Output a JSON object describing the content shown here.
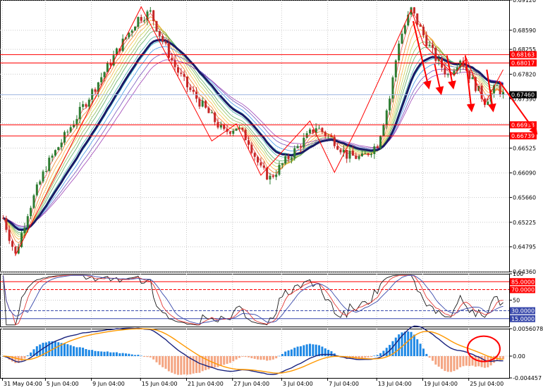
{
  "colors": {
    "background": "#ffffff",
    "grid": "#c8c8c8",
    "bull": "#2e7d32",
    "bear": "#c62828",
    "ma_slow": "#1a1a66",
    "red": "#ff0000",
    "rsi_main": "#1a1a1a",
    "rsi_alt1": "#e53935",
    "rsi_alt2": "#3949ab",
    "macd_pos": "#1e88e5",
    "macd_neg": "#f4a582",
    "macd_line": "#1a237e",
    "signal_line": "#ff9800",
    "current_tag": "#000000"
  },
  "icons": [
    "highlight-circle",
    "trend-arrow"
  ],
  "chart_data": [
    {
      "type": "candlestick",
      "ylim": [
        0.6436,
        0.6912
      ],
      "y_ticks": [
        "0.69120",
        "0.68590",
        "0.68255",
        "0.67820",
        "0.67390",
        "0.66955",
        "0.66525",
        "0.66090",
        "0.65660",
        "0.65225",
        "0.64795",
        "0.64360"
      ],
      "tick_values": [
        0.6912,
        0.6859,
        0.68255,
        0.6782,
        0.6739,
        0.66955,
        0.66525,
        0.6609,
        0.6566,
        0.65225,
        0.64795,
        0.6436
      ],
      "x_labels": [
        "31 May 04:00",
        "5 Jun 04:00",
        "9 Jun 04:00",
        "15 Jun 04:00",
        "21 Jun 04:00",
        "27 Jun 04:00",
        "3 Jul 04:00",
        "7 Jul 04:00",
        "13 Jul 04:00",
        "19 Jul 04:00",
        "25 Jul 04:00"
      ],
      "label_bar_index": [
        0,
        14,
        29,
        45,
        60,
        75,
        91,
        106,
        122,
        137,
        152
      ],
      "bar_count": 164,
      "grid": true,
      "horizontal_levels": [
        {
          "value": 0.68163,
          "label": "0.68163"
        },
        {
          "value": 0.68017,
          "label": "0.68017"
        },
        {
          "value": 0.66933,
          "label": "0.66933"
        },
        {
          "value": 0.66739,
          "label": "0.66739"
        }
      ],
      "current_price": {
        "value": 0.6746,
        "label": "0.67460"
      },
      "price_path": [
        [
          0,
          0.653
        ],
        [
          4,
          0.6465
        ],
        [
          8,
          0.654
        ],
        [
          14,
          0.662
        ],
        [
          22,
          0.669
        ],
        [
          30,
          0.676
        ],
        [
          38,
          0.683
        ],
        [
          44,
          0.688
        ],
        [
          48,
          0.689
        ],
        [
          52,
          0.684
        ],
        [
          56,
          0.6795
        ],
        [
          60,
          0.676
        ],
        [
          66,
          0.672
        ],
        [
          72,
          0.668
        ],
        [
          76,
          0.669
        ],
        [
          80,
          0.6665
        ],
        [
          84,
          0.6615
        ],
        [
          87,
          0.66
        ],
        [
          92,
          0.663
        ],
        [
          97,
          0.666
        ],
        [
          102,
          0.669
        ],
        [
          108,
          0.6665
        ],
        [
          112,
          0.664
        ],
        [
          117,
          0.6635
        ],
        [
          122,
          0.666
        ],
        [
          126,
          0.674
        ],
        [
          129,
          0.684
        ],
        [
          133,
          0.6895
        ],
        [
          137,
          0.685
        ],
        [
          141,
          0.681
        ],
        [
          145,
          0.678
        ],
        [
          149,
          0.681
        ],
        [
          153,
          0.677
        ],
        [
          157,
          0.6735
        ],
        [
          161,
          0.676
        ],
        [
          163,
          0.6746
        ]
      ],
      "zigzag": [
        [
          4,
          0.6465
        ],
        [
          45,
          0.69
        ],
        [
          68,
          0.6665
        ],
        [
          76,
          0.6695
        ],
        [
          84,
          0.6605
        ],
        [
          100,
          0.67
        ],
        [
          108,
          0.661
        ],
        [
          116,
          0.6695
        ],
        [
          133,
          0.6895
        ],
        [
          137,
          0.6835
        ],
        [
          147,
          0.678
        ],
        [
          151,
          0.681
        ],
        [
          157,
          0.673
        ],
        [
          163,
          0.679
        ]
      ],
      "arrows": [
        [
          [
            134,
            0.6875
          ],
          [
            139,
            0.676
          ]
        ],
        [
          [
            141,
            0.68
          ],
          [
            143,
            0.675
          ]
        ],
        [
          [
            145,
            0.6815
          ],
          [
            147,
            0.676
          ]
        ],
        [
          [
            151,
            0.6815
          ],
          [
            153,
            0.672
          ]
        ],
        [
          [
            158,
            0.679
          ],
          [
            160,
            0.672
          ]
        ],
        [
          [
            162,
            0.677
          ],
          [
            174,
            0.668
          ]
        ]
      ]
    },
    {
      "type": "line",
      "ylim": [
        0,
        100
      ],
      "y_ticks": [
        "100",
        "85.0000",
        "70.0000",
        "50",
        "30.0000",
        "15.0000"
      ],
      "tick_values": [
        100,
        85,
        70,
        50,
        30,
        15
      ],
      "levels": [
        {
          "value": 85,
          "label": "85.0000"
        },
        {
          "value": 70,
          "label": "70.0000"
        },
        {
          "value": 30,
          "label": "30.0000"
        },
        {
          "value": 15,
          "label": "15.0000"
        }
      ]
    },
    {
      "type": "bar",
      "ylim": [
        -0.004457,
        0.0056078
      ],
      "y_ticks": [
        "0.0056078",
        "0.00",
        "-0.004457"
      ],
      "tick_values": [
        0.0056078,
        0,
        -0.004457
      ]
    }
  ]
}
